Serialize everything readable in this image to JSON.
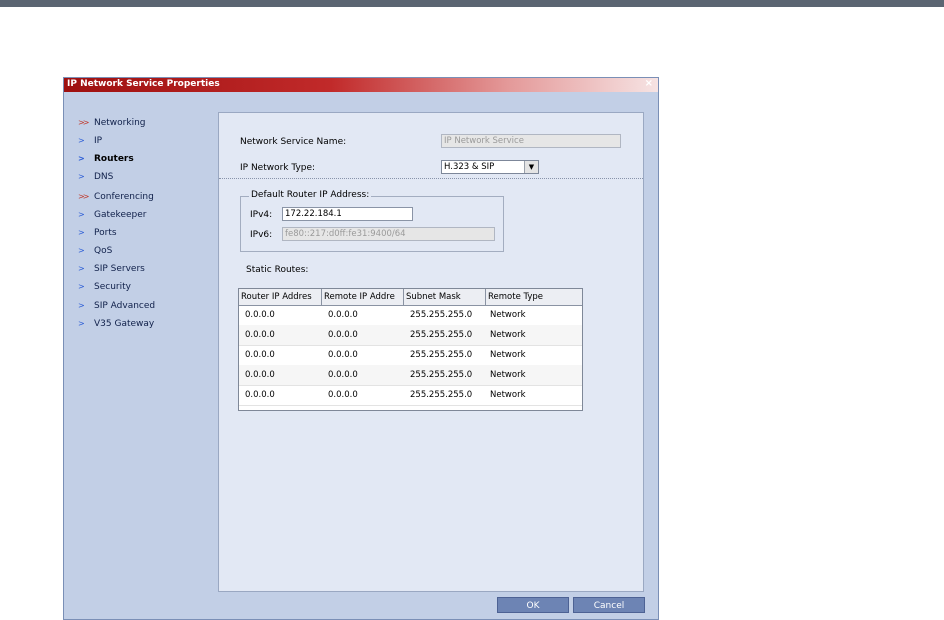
{
  "dialog": {
    "title": "IP Network Service Properties",
    "close_glyph": "×"
  },
  "nav": {
    "items": [
      {
        "label": "Networking",
        "icon": "double-chevron-icon",
        "active": false
      },
      {
        "label": "IP",
        "icon": "chevron-icon",
        "active": false
      },
      {
        "label": "Routers",
        "icon": "chevron-icon",
        "active": true
      },
      {
        "label": "DNS",
        "icon": "chevron-icon",
        "active": false
      },
      {
        "label": "Conferencing",
        "icon": "double-chevron-icon",
        "active": false
      },
      {
        "label": "Gatekeeper",
        "icon": "chevron-icon",
        "active": false
      },
      {
        "label": "Ports",
        "icon": "chevron-icon",
        "active": false
      },
      {
        "label": "QoS",
        "icon": "chevron-icon",
        "active": false
      },
      {
        "label": "SIP Servers",
        "icon": "chevron-icon",
        "active": false
      },
      {
        "label": "Security",
        "icon": "chevron-icon",
        "active": false
      },
      {
        "label": "SIP Advanced",
        "icon": "chevron-icon",
        "active": false
      },
      {
        "label": "V35 Gateway",
        "icon": "chevron-icon",
        "active": false
      }
    ]
  },
  "form": {
    "service_name_label": "Network Service Name:",
    "service_name_value": "IP Network Service",
    "network_type_label": "IP Network Type:",
    "network_type_value": "H.323 & SIP",
    "router_group_label": "Default Router IP Address:",
    "ipv4_label": "IPv4:",
    "ipv4_value": "172.22.184.1",
    "ipv6_label": "IPv6:",
    "ipv6_value": "fe80::217:d0ff:fe31:9400/64",
    "static_routes_label": "Static Routes:"
  },
  "routes": {
    "columns": [
      "Router IP Addres",
      "Remote IP Addre",
      "Subnet Mask",
      "Remote Type"
    ],
    "rows": [
      [
        "0.0.0.0",
        "0.0.0.0",
        "255.255.255.0",
        "Network"
      ],
      [
        "0.0.0.0",
        "0.0.0.0",
        "255.255.255.0",
        "Network"
      ],
      [
        "0.0.0.0",
        "0.0.0.0",
        "255.255.255.0",
        "Network"
      ],
      [
        "0.0.0.0",
        "0.0.0.0",
        "255.255.255.0",
        "Network"
      ],
      [
        "0.0.0.0",
        "0.0.0.0",
        "255.255.255.0",
        "Network"
      ]
    ]
  },
  "buttons": {
    "ok": "OK",
    "cancel": "Cancel"
  },
  "colors": {
    "title_red": "#9e1010",
    "dialog_bg": "#c2cfe6",
    "button_blue": "#6d84b4"
  }
}
